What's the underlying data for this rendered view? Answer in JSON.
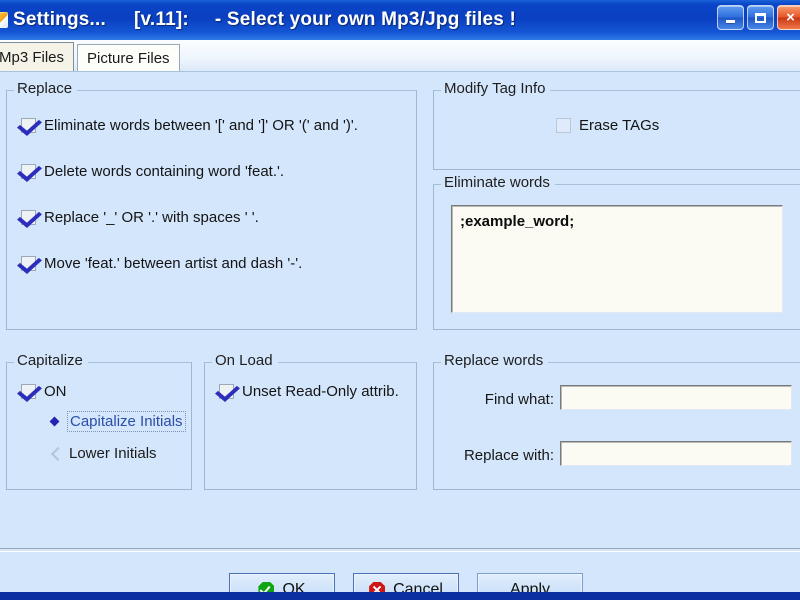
{
  "window": {
    "title_name": "Settings...",
    "title_version": "[v.11]:",
    "title_subtitle": "- Select your own Mp3/Jpg files !",
    "minimize_label": "_",
    "maximize_label": "",
    "close_label": "×"
  },
  "tabs": [
    {
      "label": "Mp3 Files",
      "active": true
    },
    {
      "label": "Picture Files",
      "active": false
    }
  ],
  "replace_group": {
    "title": "Replace",
    "items": [
      {
        "label": "Eliminate words between '[' and ']' OR '(' and ')'.",
        "checked": true
      },
      {
        "label": "Delete words containing word 'feat.'.",
        "checked": true
      },
      {
        "label": "Replace '_' OR '.' with spaces ' '.",
        "checked": true
      },
      {
        "label": "Move 'feat.' between artist and dash '-'.",
        "checked": true
      }
    ]
  },
  "modify_tag_group": {
    "title": "Modify Tag Info",
    "erase_tags_label": "Erase TAGs",
    "erase_tags_checked": false
  },
  "eliminate_words_group": {
    "title": "Eliminate words",
    "value": ";example_word;"
  },
  "capitalize_group": {
    "title": "Capitalize",
    "on_label": "ON",
    "on_checked": true,
    "options": [
      {
        "label": "Capitalize Initials",
        "selected": true
      },
      {
        "label": "Lower Initials",
        "selected": false
      }
    ]
  },
  "on_load_group": {
    "title": "On Load",
    "unset_readonly_label": "Unset Read-Only attrib.",
    "unset_readonly_checked": true
  },
  "replace_words_group": {
    "title": "Replace words",
    "find_label": "Find what:",
    "find_value": "",
    "find_placeholder": "",
    "replace_label": "Replace with:",
    "replace_value": "",
    "replace_placeholder": ""
  },
  "footer": {
    "ok_label": "OK",
    "cancel_label": "Cancel",
    "apply_label": "Apply"
  },
  "colors": {
    "dialog_background": "#d4e6fc",
    "titlebar_blue": "#0a3fc0",
    "accent_check": "#2d2dbb",
    "ok_green": "#10a410",
    "cancel_red": "#d01717"
  }
}
